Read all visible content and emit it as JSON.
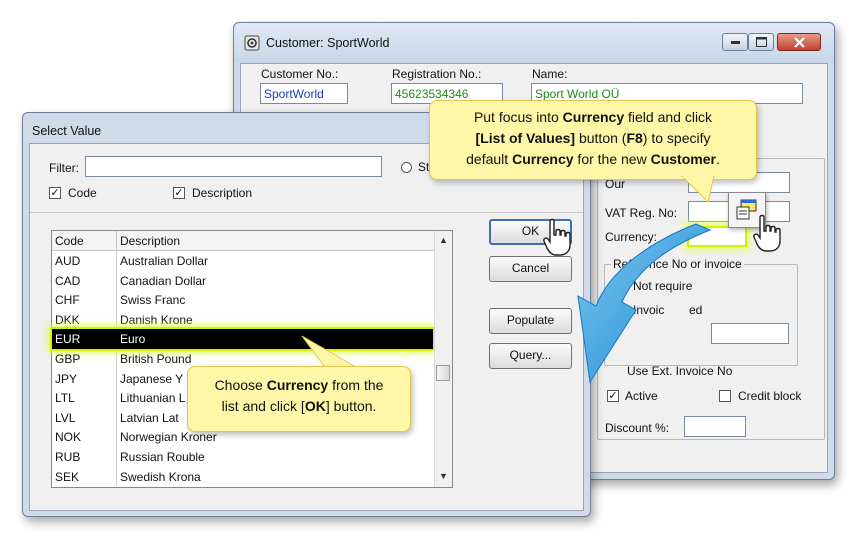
{
  "customer_window": {
    "title": "Customer: SportWorld",
    "fields": {
      "customer_no_label": "Customer No.:",
      "customer_no_value": "SportWorld",
      "registration_no_label": "Registration No.:",
      "registration_no_value": "45623534346",
      "name_label": "Name:",
      "name_value": "Sport World OÜ",
      "our_label": "Our",
      "vat_label": "VAT Reg. No:",
      "currency_label": "Currency:",
      "reference_group_label": "Reference No or invoice",
      "radio_not_required": "Not require",
      "radio_invoice": "Invoic",
      "radio_invoice_tail": "ed",
      "use_ext_invoice": "Use Ext. Invoice No",
      "active_label": "Active",
      "credit_block_label": "Credit block",
      "discount_label": "Discount %:"
    }
  },
  "select_window": {
    "title": "Select Value",
    "filter_label": "Filter:",
    "filter_value": "",
    "radio_start_label": "St",
    "code_checkbox": "Code",
    "description_checkbox": "Description",
    "columns": [
      "Code",
      "Description"
    ],
    "rows": [
      {
        "code": "AUD",
        "description": "Australian Dollar"
      },
      {
        "code": "CAD",
        "description": "Canadian Dollar"
      },
      {
        "code": "CHF",
        "description": "Swiss Franc"
      },
      {
        "code": "DKK",
        "description": "Danish Krone"
      },
      {
        "code": "EUR",
        "description": "Euro"
      },
      {
        "code": "GBP",
        "description": "British Pound"
      },
      {
        "code": "JPY",
        "description": "Japanese Y"
      },
      {
        "code": "LTL",
        "description": "Lithuanian L"
      },
      {
        "code": "LVL",
        "description": "Latvian Lat"
      },
      {
        "code": "NOK",
        "description": "Norwegian Kroner"
      },
      {
        "code": "RUB",
        "description": "Russian Rouble"
      },
      {
        "code": "SEK",
        "description": "Swedish Krona"
      }
    ],
    "selected_row": "EUR",
    "buttons": {
      "ok": "OK",
      "cancel": "Cancel",
      "populate": "Populate",
      "query": "Query..."
    }
  },
  "callouts": {
    "top": {
      "t1": "Put focus into ",
      "b1": "Currency",
      "t2": " field and click",
      "b2": "[List of Values]",
      "t3": " button (",
      "b3": "F8",
      "t4": ") to specify",
      "t5": "default ",
      "b4": "Currency",
      "t6": " for the new ",
      "b5": "Customer",
      "t7": "."
    },
    "bottom": {
      "t1": "Choose ",
      "b1": "Currency",
      "t2": " from the",
      "t3": "list and click [",
      "b2": "OK",
      "t4": "] button."
    }
  },
  "colors": {
    "highlight": "#d6ff3a",
    "arrow": "#2f9fe0",
    "callout": "#fff7a8"
  }
}
